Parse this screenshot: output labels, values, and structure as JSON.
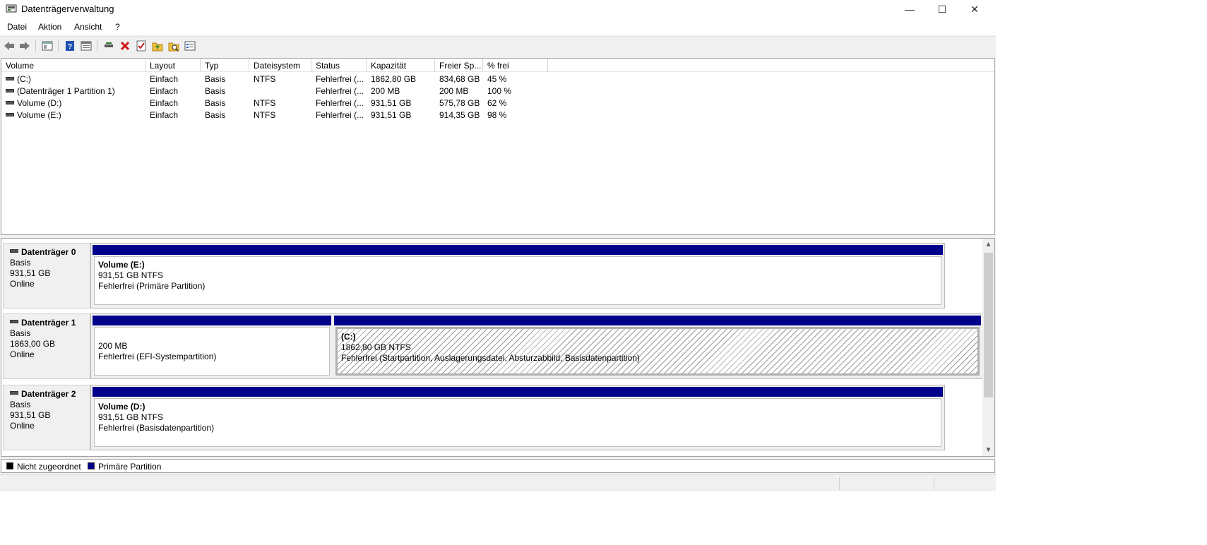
{
  "window": {
    "title": "Datenträgerverwaltung",
    "controls": {
      "minimize": "—",
      "maximize": "☐",
      "close": "✕"
    }
  },
  "menu": [
    "Datei",
    "Aktion",
    "Ansicht",
    "?"
  ],
  "toolbar": {
    "icons": [
      "back-icon",
      "forward-icon",
      "console-tree-icon",
      "help-icon",
      "view-icon",
      "connect-icon",
      "delete-icon",
      "properties-icon",
      "open-folder-icon",
      "explore-icon",
      "settings-list-icon"
    ]
  },
  "volume_list": {
    "columns": [
      "Volume",
      "Layout",
      "Typ",
      "Dateisystem",
      "Status",
      "Kapazität",
      "Freier Sp...",
      "% frei"
    ],
    "rows": [
      [
        "(C:)",
        "Einfach",
        "Basis",
        "NTFS",
        "Fehlerfrei (...",
        "1862,80 GB",
        "834,68 GB",
        "45 %"
      ],
      [
        "(Datenträger 1 Partition 1)",
        "Einfach",
        "Basis",
        "",
        "Fehlerfrei (...",
        "200 MB",
        "200 MB",
        "100 %"
      ],
      [
        "Volume (D:)",
        "Einfach",
        "Basis",
        "NTFS",
        "Fehlerfrei (...",
        "931,51 GB",
        "575,78 GB",
        "62 %"
      ],
      [
        "Volume (E:)",
        "Einfach",
        "Basis",
        "NTFS",
        "Fehlerfrei (...",
        "931,51 GB",
        "914,35 GB",
        "98 %"
      ]
    ]
  },
  "disks": [
    {
      "name": "Datenträger 0",
      "type": "Basis",
      "size": "931,51 GB",
      "state": "Online",
      "partitions": [
        {
          "name": "Volume  (E:)",
          "size": "931,51 GB NTFS",
          "status": "Fehlerfrei (Primäre Partition)"
        }
      ]
    },
    {
      "name": "Datenträger 1",
      "type": "Basis",
      "size": "1863,00 GB",
      "state": "Online",
      "partitions": [
        {
          "name": "",
          "size": "200 MB",
          "status": "Fehlerfrei (EFI-Systempartition)"
        },
        {
          "name": "(C:)",
          "size": "1862,80 GB NTFS",
          "status": "Fehlerfrei (Startpartition, Auslagerungsdatei, Absturzabbild, Basisdatenpartition)"
        }
      ]
    },
    {
      "name": "Datenträger 2",
      "type": "Basis",
      "size": "931,51 GB",
      "state": "Online",
      "partitions": [
        {
          "name": "Volume  (D:)",
          "size": "931,51 GB NTFS",
          "status": "Fehlerfrei (Basisdatenpartition)"
        }
      ]
    }
  ],
  "legend": {
    "items": [
      {
        "label": "Nicht zugeordnet",
        "color": "#000000"
      },
      {
        "label": "Primäre Partition",
        "color": "#00008b"
      }
    ]
  },
  "scrollbar": {
    "up": "▲",
    "down": "▼"
  }
}
